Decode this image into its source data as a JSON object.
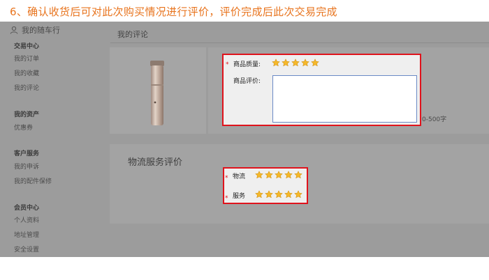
{
  "caption": "6、确认收货后可对此次购买情况进行评价，评价完成后此次交易完成",
  "sidebar": {
    "user_label": "我的随车行",
    "groups": [
      {
        "title": "交易中心",
        "items": [
          "我的订单",
          "我的收藏",
          "我的评论"
        ]
      },
      {
        "title": "我的资产",
        "items": [
          "优惠券"
        ]
      },
      {
        "title": "客户服务",
        "items": [
          "我的申诉",
          "我的配件保修"
        ]
      },
      {
        "title": "会员中心",
        "items": [
          "个人资料",
          "地址管理",
          "安全设置"
        ]
      }
    ]
  },
  "main": {
    "page_title": "我的评论",
    "review": {
      "quality_label": "商品质量:",
      "quality_rating": 5,
      "comment_label": "商品评价:",
      "comment_value": "",
      "length_hint": "0-500字"
    },
    "logistics": {
      "section_title": "物流服务评价",
      "rows": [
        {
          "label": "物流",
          "rating": 5
        },
        {
          "label": "服务",
          "rating": 5
        }
      ]
    },
    "required_mark": "*"
  },
  "colors": {
    "caption": "#e8741e",
    "highlight_border": "#e0131c",
    "star_fill": "#f5b82a",
    "overlay_gray": "#9c9c9c"
  },
  "icons": {
    "user": "user-icon",
    "star": "star-icon"
  }
}
